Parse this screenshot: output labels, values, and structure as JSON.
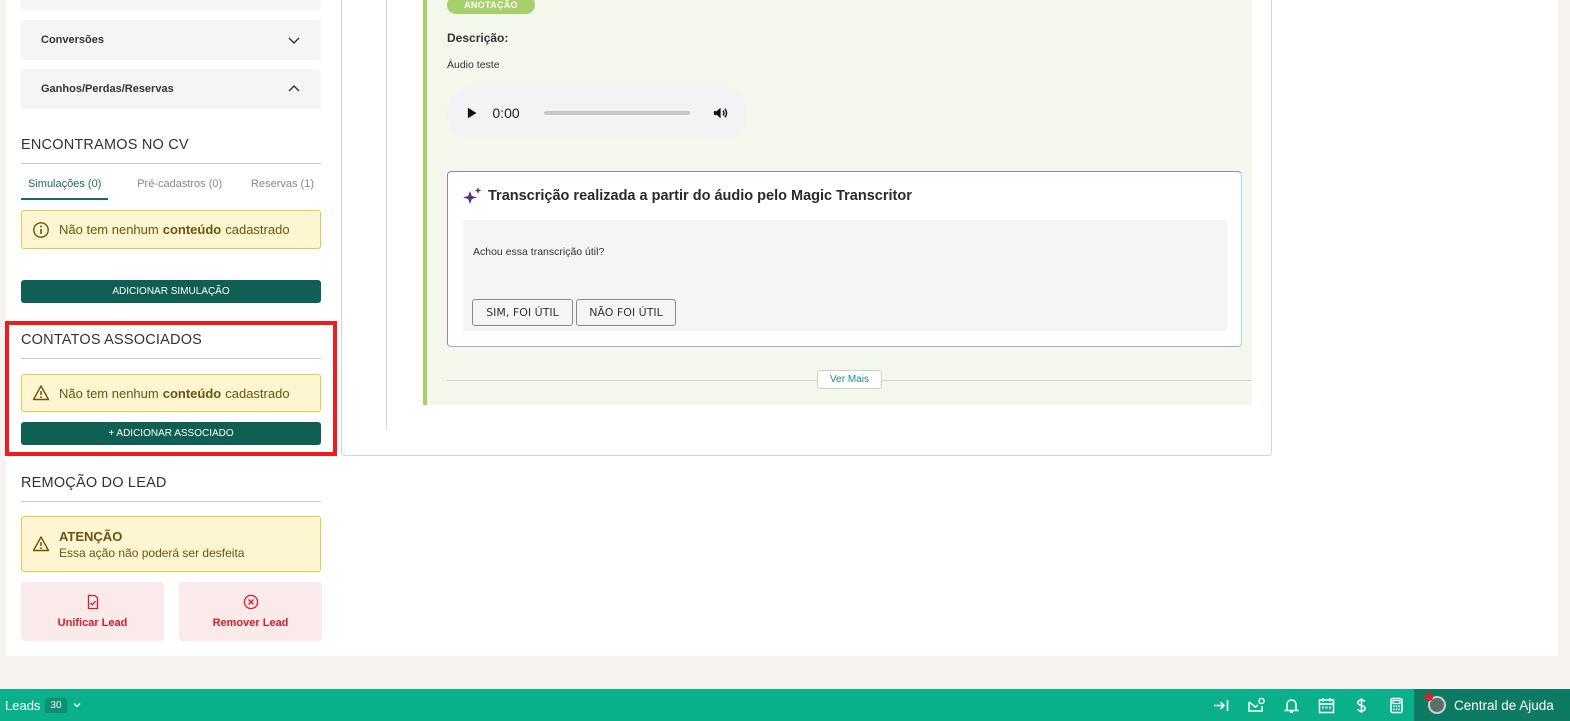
{
  "left": {
    "accordions": [
      {
        "label": "Conversões",
        "state": "collapsed"
      },
      {
        "label": "Ganhos/Perdas/Reservas",
        "state": "expanded"
      }
    ],
    "found_title": "ENCONTRAMOS NO CV",
    "tabs": [
      "Simulações (0)",
      "Pré-cadastros (0)",
      "Reservas (1)"
    ],
    "empty_prefix": "Não tem nenhum",
    "empty_bold": "conteúdo",
    "empty_suffix": "cadastrado",
    "add_simulation": "ADICIONAR SIMULAÇÃO",
    "contacts_title": "CONTATOS ASSOCIADOS",
    "add_associate": "+ ADICIONAR ASSOCIADO",
    "removal_title": "REMOÇÃO DO LEAD",
    "attention_title": "ATENÇÃO",
    "attention_text": "Essa ação não poderá ser desfeita",
    "unify": "Unificar Lead",
    "remove": "Remover Lead"
  },
  "note": {
    "tag": "ANOTAÇÃO",
    "desc_label": "Descrição:",
    "desc_text": "Áudio teste",
    "audio_time": "0:00",
    "transcription_title": "Transcrição realizada a partir do áudio pelo Magic Transcritor",
    "question": "Achou essa transcrição útil?",
    "yes": "SIM, FOI ÚTIL",
    "no": "NÃO FOI ÚTIL",
    "see_more": "Ver Mais"
  },
  "bottombar": {
    "leads_label": "Leads",
    "leads_count": "30",
    "help": "Central de Ajuda"
  },
  "colors": {
    "primary_dark": "#0f5f55",
    "bar_green": "#0ab08a",
    "warning_bg": "#fdf6d1",
    "danger": "#d0202a",
    "highlight": "#ee1c1c"
  }
}
